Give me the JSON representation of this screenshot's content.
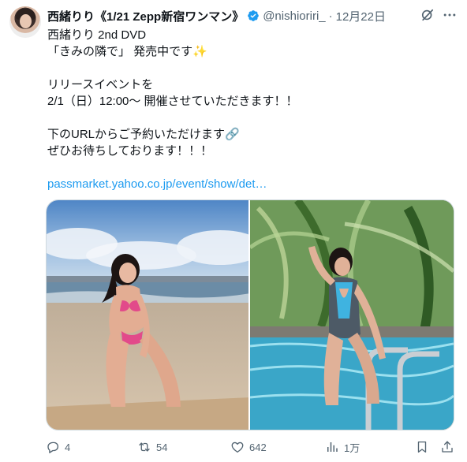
{
  "tweet": {
    "display_name": "西緒りり《1/21 Zepp新宿ワンマン》",
    "handle": "@nishioriri_",
    "separator": "·",
    "date": "12月22日",
    "lines": [
      "西緒りり 2nd DVD",
      "「きみの隣で」 発売中です✨",
      "",
      "リリースイベントを",
      "2/1（日）12:00〜 開催させていただきます！！",
      "",
      "下のURLからご予約いただけます🔗",
      "ぜひお待ちしております！！！",
      ""
    ],
    "link": "passmarket.yahoo.co.jp/event/show/det…"
  },
  "actions": {
    "replies": "4",
    "reposts": "54",
    "likes": "642",
    "views": "1万"
  },
  "colors": {
    "accent": "#1d9bf0",
    "muted": "#536471",
    "text": "#0f1419"
  },
  "icons": [
    "verified-badge-icon",
    "grok-icon",
    "more-icon",
    "reply-icon",
    "repost-icon",
    "like-icon",
    "views-icon",
    "bookmark-icon",
    "share-icon"
  ]
}
